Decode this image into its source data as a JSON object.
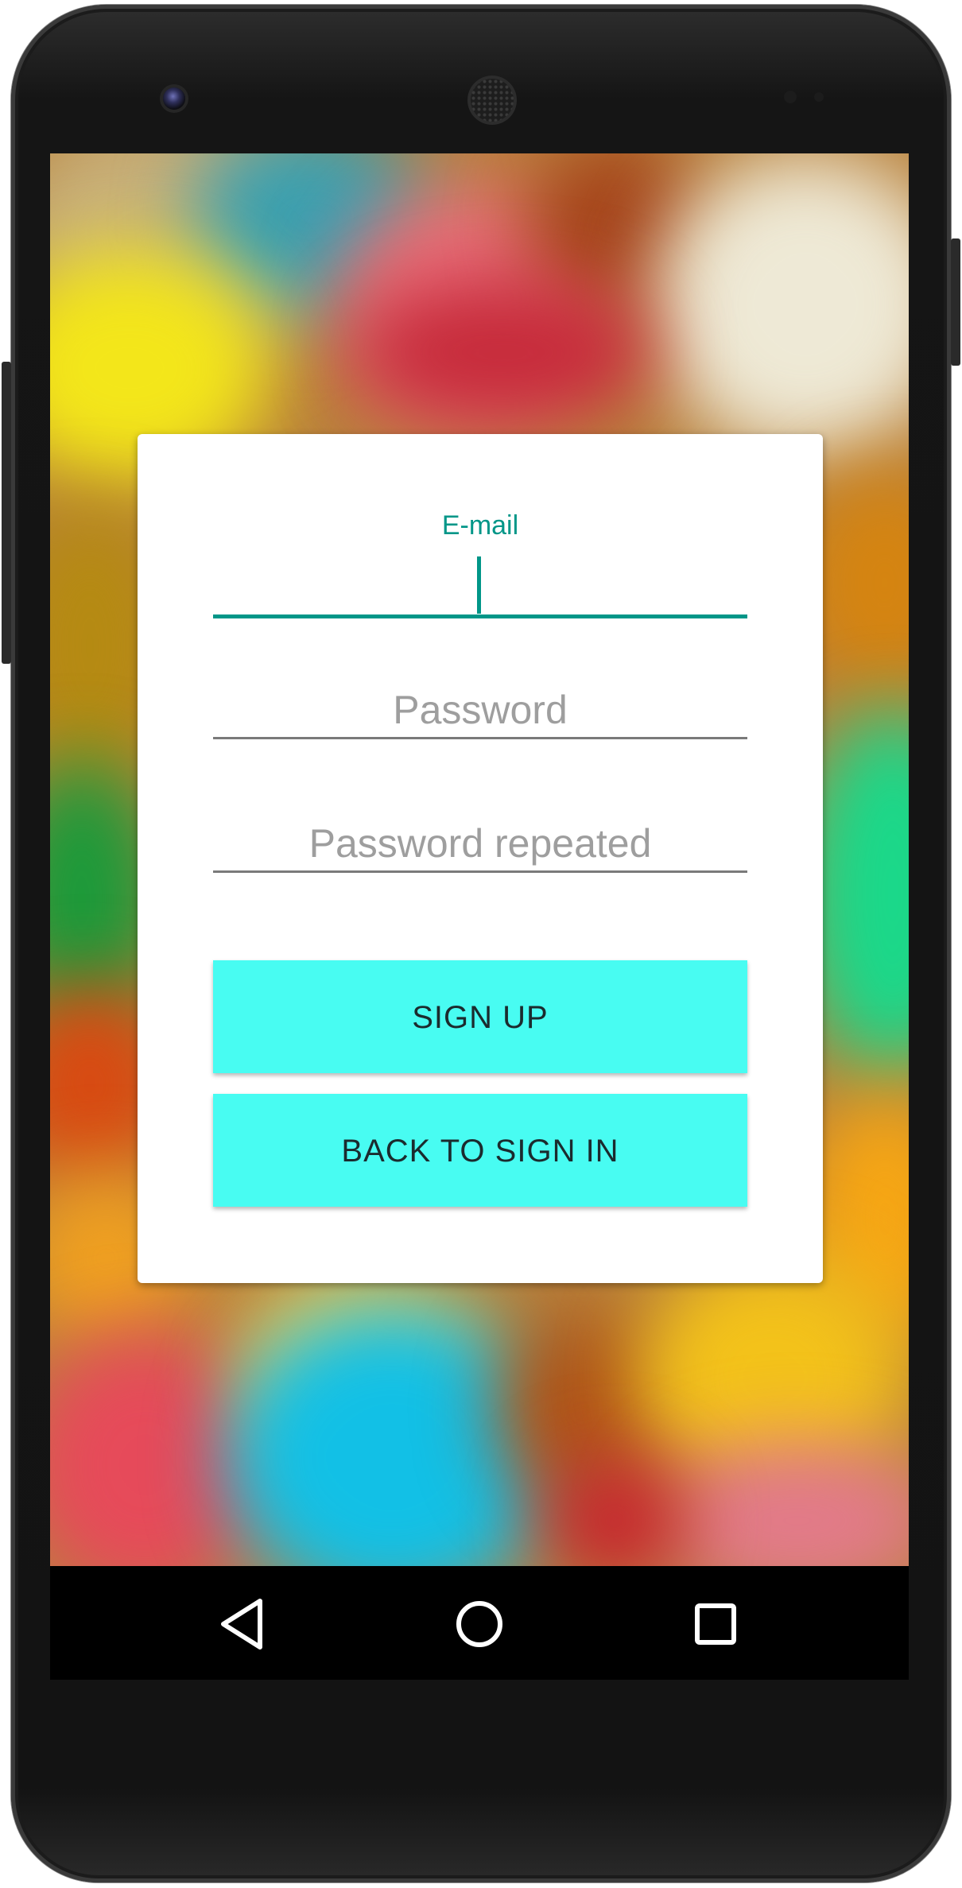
{
  "form": {
    "email_label": "E-mail",
    "email_value": "",
    "password_placeholder": "Password",
    "password_repeat_placeholder": "Password repeated"
  },
  "buttons": {
    "sign_up": "SIGN UP",
    "back_to_sign_in": "BACK TO SIGN IN"
  },
  "navbar": {
    "back_icon": "back-triangle-icon",
    "home_icon": "home-circle-icon",
    "recents_icon": "recents-square-icon"
  },
  "colors": {
    "accent": "#009688",
    "button": "#48FCF2",
    "hint": "#9E9E9E",
    "navbar": "#000000"
  }
}
